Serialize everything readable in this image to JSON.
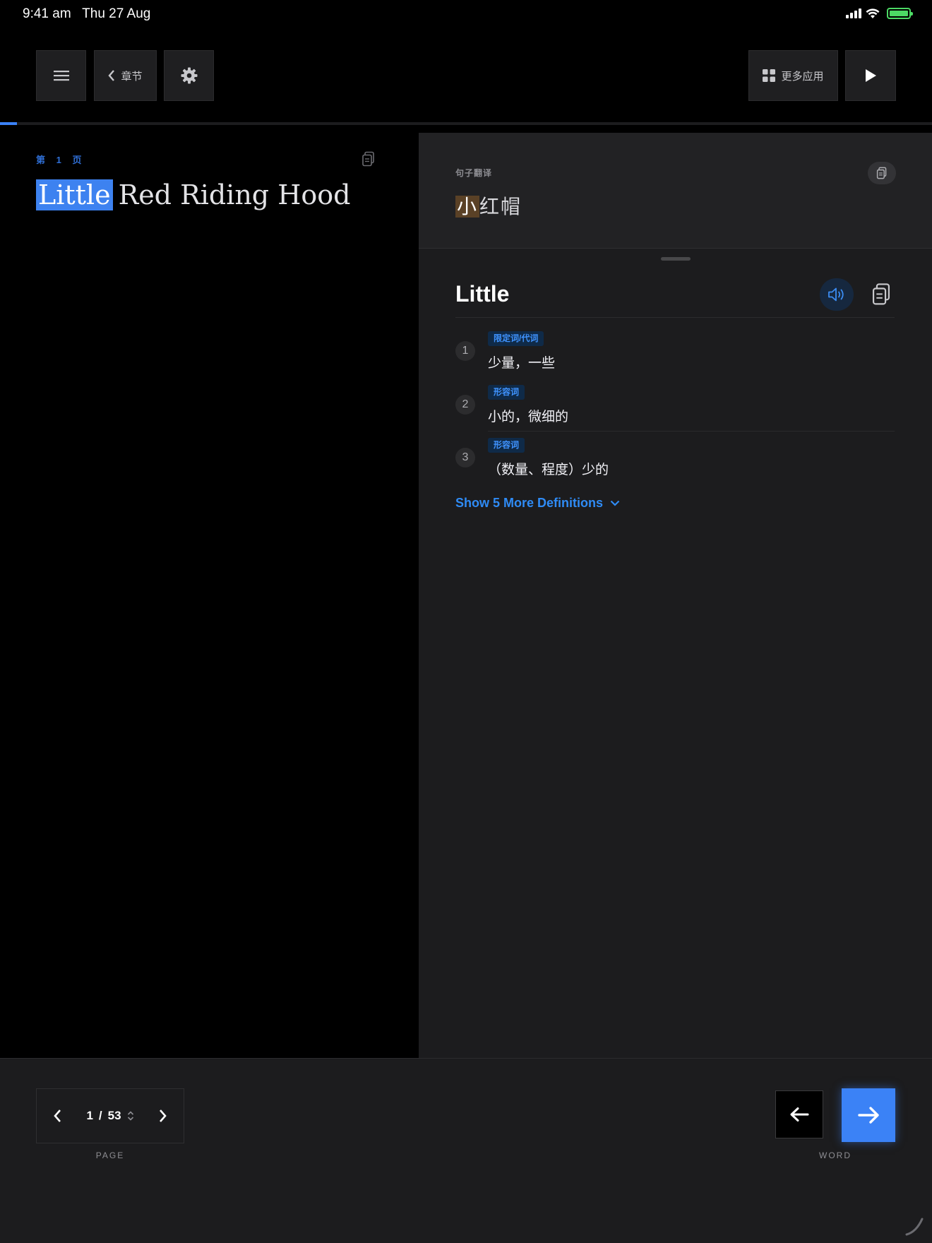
{
  "status": {
    "time": "9:41 am",
    "date": "Thu 27 Aug",
    "battery_color": "#4cd964"
  },
  "toolbar": {
    "chapters_label": "章节",
    "more_apps_label": "更多应用"
  },
  "reading": {
    "progress_fraction": 0.018,
    "page_label": "第 1 页",
    "highlighted_word": "Little",
    "rest_of_title": "Red Riding Hood"
  },
  "translation": {
    "label": "句子翻译",
    "highlighted": "小",
    "rest": "红帽"
  },
  "word": {
    "headword": "Little",
    "definitions": [
      {
        "num": "1",
        "pos": "限定词/代词",
        "text": "少量，一些"
      },
      {
        "num": "2",
        "pos": "形容词",
        "text": "小的，微细的"
      },
      {
        "num": "3",
        "pos": "形容词",
        "text": "（数量、程度）少的"
      }
    ],
    "show_more_label": "Show 5 More Definitions"
  },
  "pager": {
    "current": "1",
    "separator": "/",
    "total": "53",
    "caption": "PAGE"
  },
  "word_nav": {
    "caption": "WORD"
  },
  "colors": {
    "accent": "#3b82f6",
    "link": "#2f8bf5",
    "word_highlight": "#3d82f0",
    "translation_highlight": "#5a4126"
  },
  "icons": {
    "menu": "menu-icon",
    "chapters": "chevron-left-icon",
    "settings": "gear-icon",
    "apps": "grid-icon",
    "play": "play-icon",
    "copy": "copy-icon",
    "speaker": "speaker-icon"
  }
}
